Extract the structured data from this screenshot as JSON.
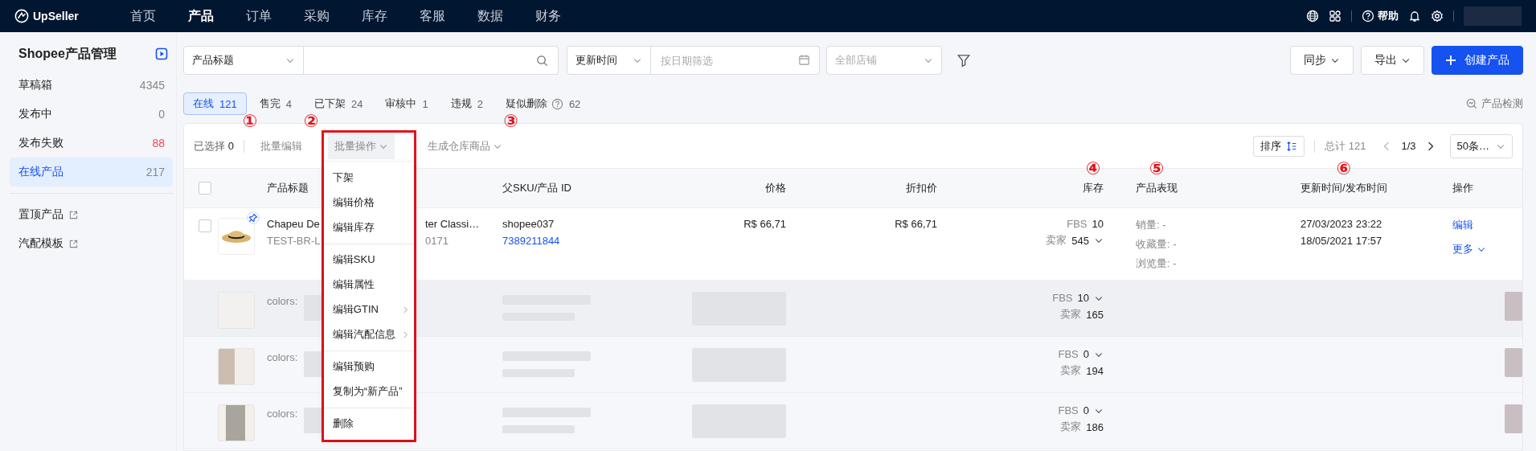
{
  "topbar": {
    "logo": "UpSeller",
    "nav": [
      {
        "label": "首页",
        "selected": false
      },
      {
        "label": "产品",
        "selected": true
      },
      {
        "label": "订单",
        "selected": false
      },
      {
        "label": "采购",
        "selected": false
      },
      {
        "label": "库存",
        "selected": false
      },
      {
        "label": "客服",
        "selected": false
      },
      {
        "label": "数据",
        "selected": false
      },
      {
        "label": "财务",
        "selected": false
      }
    ],
    "help": "帮助"
  },
  "sidebar": {
    "title": "Shopee产品管理",
    "items": [
      {
        "label": "草稿箱",
        "count": "4345",
        "alert": false,
        "selected": false
      },
      {
        "label": "发布中",
        "count": "0",
        "alert": false,
        "selected": false
      },
      {
        "label": "发布失败",
        "count": "88",
        "alert": true,
        "selected": false
      },
      {
        "label": "在线产品",
        "count": "217",
        "alert": false,
        "selected": true
      }
    ],
    "links": [
      "置顶产品",
      "汽配模板"
    ]
  },
  "filters": {
    "field_select": "产品标题",
    "time_select": "更新时间",
    "date_placeholder": "按日期筛选",
    "store_placeholder": "全部店铺"
  },
  "actions": [
    {
      "label": "同步",
      "kind": "dropdown"
    },
    {
      "label": "导出",
      "kind": "dropdown"
    },
    {
      "label": "创建产品",
      "kind": "primary"
    }
  ],
  "status_tabs": [
    {
      "label": "在线",
      "count": "121",
      "selected": true,
      "help": false
    },
    {
      "label": "售完",
      "count": "4",
      "selected": false,
      "help": false
    },
    {
      "label": "已下架",
      "count": "24",
      "selected": false,
      "help": false
    },
    {
      "label": "审核中",
      "count": "1",
      "selected": false,
      "help": false
    },
    {
      "label": "违规",
      "count": "2",
      "selected": false,
      "help": false
    },
    {
      "label": "疑似删除",
      "count": "62",
      "selected": false,
      "help": true
    }
  ],
  "detect_link": "产品检测",
  "toolbar": {
    "selected_label": "已选择",
    "selected_count": "0",
    "items": [
      {
        "label": "批量编辑",
        "marker": "①",
        "kind": "plain"
      },
      {
        "label": "批量操作",
        "marker": "②",
        "kind": "menu",
        "expanded": true
      },
      {
        "label": "生成仓库商品",
        "marker": "③",
        "kind": "dropdown"
      }
    ],
    "sort": "排序",
    "total": "总计 121",
    "page": "1/3",
    "page_size": "50条…"
  },
  "menu": {
    "groups": [
      [
        {
          "label": "下架",
          "submenu": false
        },
        {
          "label": "编辑价格",
          "submenu": false
        },
        {
          "label": "编辑库存",
          "submenu": false
        }
      ],
      [
        {
          "label": "编辑SKU",
          "submenu": false
        },
        {
          "label": "编辑属性",
          "submenu": false
        },
        {
          "label": "编辑GTIN",
          "submenu": true
        },
        {
          "label": "编辑汽配信息",
          "submenu": true
        }
      ],
      [
        {
          "label": "编辑预购",
          "submenu": false
        },
        {
          "label": "复制为“新产品”",
          "submenu": false
        }
      ],
      [
        {
          "label": "删除",
          "submenu": false
        }
      ]
    ]
  },
  "table": {
    "select_all_checked": false,
    "columns": [
      {
        "label": "产品标题"
      },
      {
        "label": "父SKU/产品 ID"
      },
      {
        "label": "价格"
      },
      {
        "label": "折扣价"
      },
      {
        "label": "库存",
        "marker": "④"
      },
      {
        "label": "产品表现",
        "marker": "⑤"
      },
      {
        "label": "更新时间/发布时间",
        "marker": "⑥"
      },
      {
        "label": "操作"
      }
    ],
    "product": {
      "checked": false,
      "pinned": true,
      "title_parts": [
        "Chapeu De",
        "ter Classi…"
      ],
      "sku_parts": [
        "TEST-BR-L",
        "0171"
      ],
      "parent_sku": "shopee037",
      "product_id": "7389211844",
      "price": "R$ 66,71",
      "discount_price": "R$ 66,71",
      "stock": [
        {
          "label": "FBS",
          "value": "10",
          "caret": false
        },
        {
          "label": "卖家",
          "value": "545",
          "caret": true
        }
      ],
      "performance": [
        "销量: -",
        "收藏量: -",
        "浏览量: -"
      ],
      "updated": "27/03/2023 23:22",
      "published": "18/05/2021 17:57",
      "actions": [
        {
          "label": "编辑",
          "kind": "link"
        },
        {
          "label": "更多",
          "kind": "dropdown"
        }
      ]
    },
    "variants": [
      {
        "label": "colors:",
        "stock": [
          {
            "label": "FBS",
            "value": "10",
            "caret": true
          },
          {
            "label": "卖家",
            "value": "165",
            "caret": false
          }
        ]
      },
      {
        "label": "colors:",
        "stock": [
          {
            "label": "FBS",
            "value": "0",
            "caret": true
          },
          {
            "label": "卖家",
            "value": "194",
            "caret": false
          }
        ]
      },
      {
        "label": "colors:",
        "stock": [
          {
            "label": "FBS",
            "value": "0",
            "caret": true
          },
          {
            "label": "卖家",
            "value": "186",
            "caret": false
          }
        ]
      }
    ]
  }
}
